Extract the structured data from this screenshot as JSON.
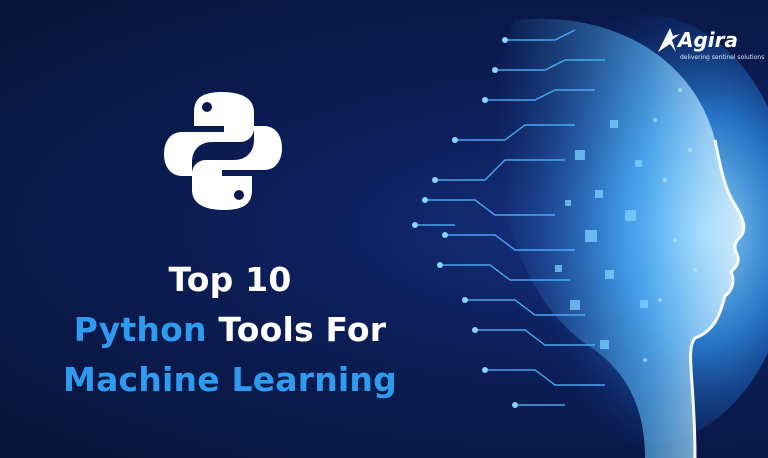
{
  "headline": {
    "line1": "Top 10",
    "line2_accent": "Python",
    "line2_rest": " Tools For",
    "line3_accent": "Machine Learning"
  },
  "brand": {
    "name": "Agira",
    "tagline": "delivering sentinel solutions"
  },
  "icons": {
    "python": "python-logo-icon",
    "brand": "agira-mark-icon",
    "face": "digital-face-illustration"
  },
  "colors": {
    "background": "#0a1a4c",
    "accent": "#2e9bf0",
    "text": "#ffffff"
  }
}
